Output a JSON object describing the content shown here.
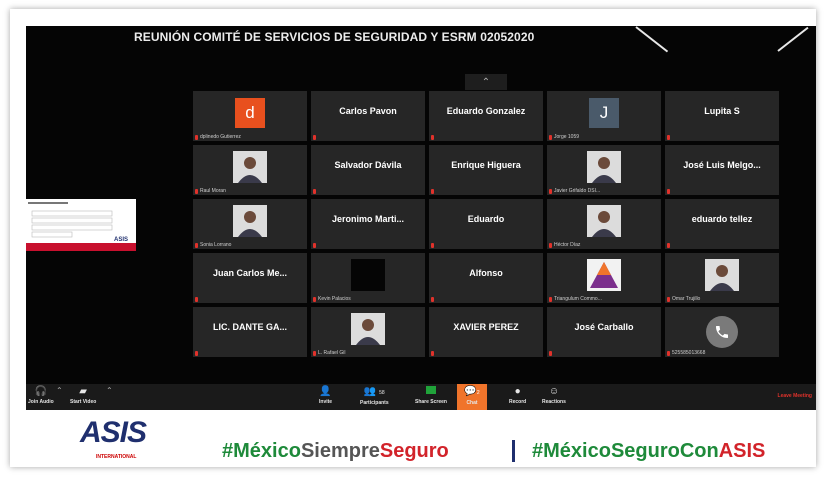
{
  "meeting": {
    "title": "REUNIÓN COMITÉ DE SERVICIOS DE SEGURIDAD Y ESRM 02052020"
  },
  "gallery": {
    "collapse_icon": "chevron-up-icon",
    "participants": [
      {
        "display": "d",
        "label": "dplinedo Gutierrez",
        "kind": "letter",
        "color": "#e8501e",
        "muted": true
      },
      {
        "display": "Carlos Pavon",
        "label": "",
        "kind": "name",
        "muted": true
      },
      {
        "display": "Eduardo Gonzalez",
        "label": "",
        "kind": "name",
        "muted": true
      },
      {
        "display": "J",
        "label": "Jorge 1059",
        "kind": "letter",
        "color": "#4a5a6a",
        "muted": true
      },
      {
        "display": "Lupita S",
        "label": "",
        "kind": "name",
        "muted": true
      },
      {
        "display": "",
        "label": "Raul Moran",
        "kind": "photo",
        "muted": true
      },
      {
        "display": "Salvador Dávila",
        "label": "",
        "kind": "name",
        "muted": true
      },
      {
        "display": "Enrique Higuera",
        "label": "",
        "kind": "name",
        "muted": true
      },
      {
        "display": "",
        "label": "Javier Grifaldo DSI...",
        "kind": "photo",
        "muted": true
      },
      {
        "display": "José Luis Melgo...",
        "label": "",
        "kind": "name",
        "muted": true
      },
      {
        "display": "",
        "label": "Sonia Lorrano",
        "kind": "photo",
        "muted": true
      },
      {
        "display": "Jeronimo Marti...",
        "label": "",
        "kind": "name",
        "muted": true
      },
      {
        "display": "Eduardo",
        "label": "",
        "kind": "name",
        "muted": true
      },
      {
        "display": "",
        "label": "Héctor Díaz",
        "kind": "photo",
        "muted": true
      },
      {
        "display": "eduardo tellez",
        "label": "",
        "kind": "name",
        "muted": true
      },
      {
        "display": "Juan Carlos Me...",
        "label": "",
        "kind": "name",
        "muted": true
      },
      {
        "display": "",
        "label": "Kevin Palacios",
        "kind": "photo-dark",
        "muted": true
      },
      {
        "display": "Alfonso",
        "label": "",
        "kind": "name",
        "muted": true
      },
      {
        "display": "",
        "label": "Triangulum Commo...",
        "kind": "logo",
        "muted": true
      },
      {
        "display": "",
        "label": "Omar Trujillo",
        "kind": "photo",
        "muted": true
      },
      {
        "display": "LIC. DANTE GA...",
        "label": "",
        "kind": "name",
        "muted": true
      },
      {
        "display": "",
        "label": "L. Rafael Gil",
        "kind": "photo",
        "muted": true
      },
      {
        "display": "XAVIER PEREZ",
        "label": "",
        "kind": "name",
        "muted": true
      },
      {
        "display": "José Carballo",
        "label": "",
        "kind": "name",
        "muted": true
      },
      {
        "display": "",
        "label": "525585013668",
        "kind": "phone",
        "muted": true
      }
    ]
  },
  "toolbar": {
    "join_audio": "Join Audio",
    "start_video": "Start Video",
    "invite": "Invite",
    "participants": "Participants",
    "participants_count": "58",
    "share_screen": "Share Screen",
    "chat": "Chat",
    "chat_badge": "2",
    "record": "Record",
    "reactions": "Reactions",
    "leave": "Leave Meeting",
    "colors": {
      "share": "#20a33a",
      "chat": "#f0742b",
      "leave": "#e0322b"
    }
  },
  "banner": {
    "logo": "ASIS",
    "logo_sub": "INTERNATIONAL",
    "hashtag1_a": "#México",
    "hashtag1_b": "Siempre",
    "hashtag1_c": "Seguro",
    "hashtag2_a": "#México",
    "hashtag2_b": "SeguroCon",
    "hashtag2_c": "ASIS"
  }
}
